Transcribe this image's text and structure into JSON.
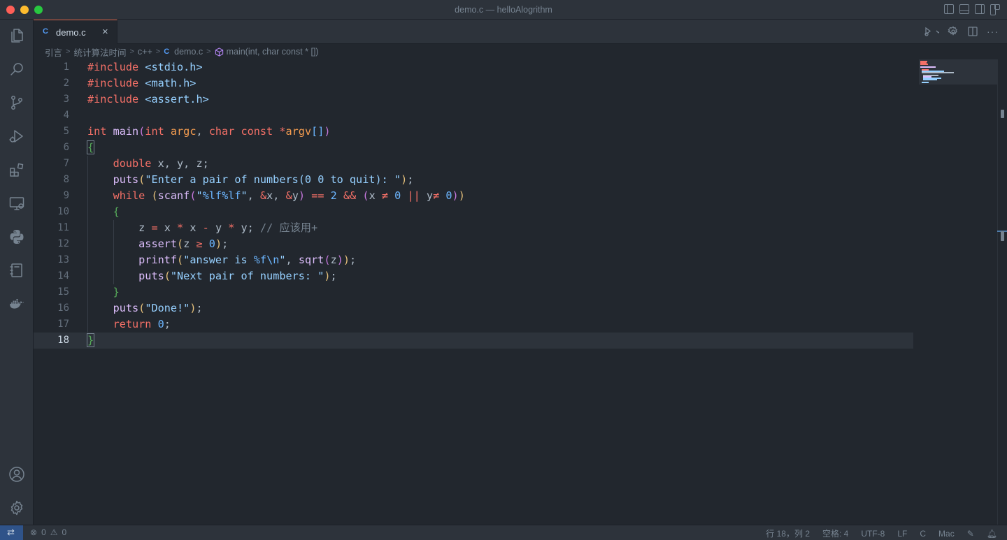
{
  "window": {
    "title": "demo.c — helloAlogrithm"
  },
  "tabs": [
    {
      "icon_text": "C",
      "label": "demo.c",
      "close": "×"
    }
  ],
  "tab_actions": {
    "more": "···"
  },
  "breadcrumb": [
    {
      "label": "引言"
    },
    {
      "label": "统计算法时间"
    },
    {
      "label": "c++"
    },
    {
      "icon_text": "C",
      "label": "demo.c"
    },
    {
      "label": "main(int, char const * [])"
    }
  ],
  "editor": {
    "active_line": 18,
    "line_numbers": [
      "1",
      "2",
      "3",
      "4",
      "5",
      "6",
      "7",
      "8",
      "9",
      "10",
      "11",
      "12",
      "13",
      "14",
      "15",
      "16",
      "17",
      "18"
    ],
    "code": {
      "l1a": "#include ",
      "l1b": "<stdio.h>",
      "l2a": "#include ",
      "l2b": "<math.h>",
      "l3a": "#include ",
      "l3b": "<assert.h>",
      "l5a": "int ",
      "l5b": "main",
      "l5c": "(",
      "l5d": "int ",
      "l5e": "argc",
      "l5f": ", ",
      "l5g": "char const ",
      "l5h": "*",
      "l5i": "argv",
      "l5j": "[]",
      "l5k": ")",
      "l6": "{",
      "l7a": "double ",
      "l7b": "x, y, z;",
      "l8a": "puts",
      "l8b": "(",
      "l8c": "\"Enter a pair of numbers(0 0 to quit): \"",
      "l8d": ")",
      "l8e": ";",
      "l9a": "while ",
      "l9b": "(",
      "l9c": "scanf",
      "l9d": "(",
      "l9e": "\"",
      "l9f": "%lf%lf",
      "l9g": "\"",
      "l9h": ", ",
      "l9i": "&",
      "l9j": "x, ",
      "l9k": "&",
      "l9l": "y",
      "l9m": ")",
      "l9n": " ",
      "l9o": "==",
      "l9p": " ",
      "l9q": "2",
      "l9r": " ",
      "l9s": "&&",
      "l9t": " ",
      "l9u": "(",
      "l9v": "x ",
      "l9w": "≠",
      "l9x": " ",
      "l9y": "0",
      "l9z": " ",
      "l9aa": "||",
      "l9ab": " y",
      "l9ac": "≠",
      "l9ad": " ",
      "l9ae": "0",
      "l9af": ")",
      "l9ag": ")",
      "l10": "{",
      "l11a": "z ",
      "l11b": "=",
      "l11c": " x ",
      "l11d": "*",
      "l11e": " x ",
      "l11f": "-",
      "l11g": " y ",
      "l11h": "*",
      "l11i": " y; ",
      "l11j": "// 应该用+",
      "l12a": "assert",
      "l12b": "(",
      "l12c": "z ",
      "l12d": "≥",
      "l12e": " ",
      "l12f": "0",
      "l12g": ")",
      "l12h": ";",
      "l13a": "printf",
      "l13b": "(",
      "l13c": "\"answer is ",
      "l13d": "%f",
      "l13e": "\\n",
      "l13f": "\"",
      "l13g": ", ",
      "l13h": "sqrt",
      "l13i": "(",
      "l13j": "z",
      "l13k": ")",
      "l13l": ")",
      "l13m": ";",
      "l14a": "puts",
      "l14b": "(",
      "l14c": "\"Next pair of numbers: \"",
      "l14d": ")",
      "l14e": ";",
      "l15": "}",
      "l16a": "puts",
      "l16b": "(",
      "l16c": "\"Done!\"",
      "l16d": ")",
      "l16e": ";",
      "l17a": "return ",
      "l17b": "0",
      "l17c": ";",
      "l18": "}"
    }
  },
  "statusbar": {
    "errors": "0",
    "warnings": "0",
    "cursor_position": "行 18，列 2",
    "indentation": "空格: 4",
    "encoding": "UTF-8",
    "eol": "LF",
    "language": "C",
    "platform": "Mac"
  },
  "colors": {
    "editor_bg": "#22272e",
    "keyword": "#f47067",
    "function": "#dcbdfb",
    "string": "#96d0ff",
    "parameter": "#f69d50",
    "tab_border": "#ec775c"
  }
}
